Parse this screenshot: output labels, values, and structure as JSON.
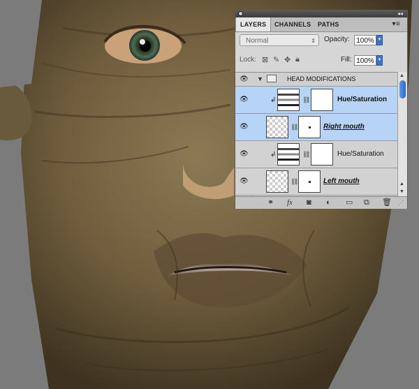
{
  "panel": {
    "tabs": [
      {
        "label": "LAYERS",
        "active": true
      },
      {
        "label": "CHANNELS",
        "active": false
      },
      {
        "label": "PATHS",
        "active": false
      }
    ],
    "blend_mode": "Normal",
    "opacity_label": "Opacity:",
    "opacity_value": "100%",
    "lock_label": "Lock:",
    "fill_label": "Fill:",
    "fill_value": "100%"
  },
  "layers": {
    "group_name": "HEAD MODIFICATIONS",
    "items": [
      {
        "name": "Hue/Saturation",
        "type": "adjustment",
        "selected": true,
        "clipped": true
      },
      {
        "name": "Right mouth",
        "type": "pixel",
        "selected": true,
        "clipped": false
      },
      {
        "name": "Hue/Saturation",
        "type": "adjustment",
        "selected": false,
        "clipped": true
      },
      {
        "name": "Left mouth",
        "type": "pixel",
        "selected": false,
        "clipped": false
      }
    ]
  },
  "bottom_icons": [
    "link-icon",
    "fx-icon",
    "mask-icon",
    "adjustment-icon",
    "folder-icon",
    "new-layer-icon",
    "trash-icon"
  ],
  "colors": {
    "selection": "#b7d3f5",
    "accent": "#3b74c8"
  }
}
